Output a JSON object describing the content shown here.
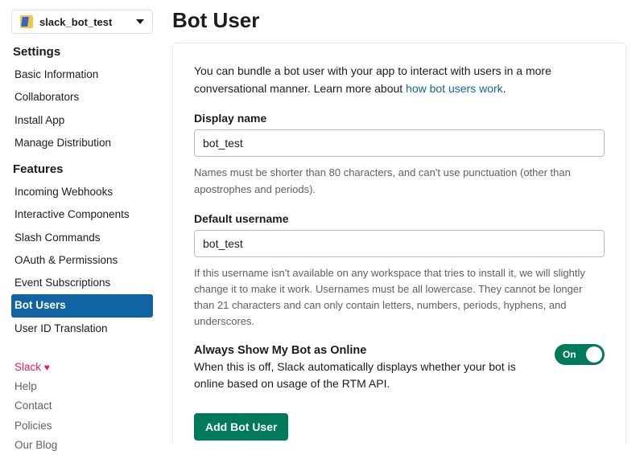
{
  "app_selector": {
    "name": "slack_bot_test"
  },
  "sidebar": {
    "settings_heading": "Settings",
    "settings_items": [
      "Basic Information",
      "Collaborators",
      "Install App",
      "Manage Distribution"
    ],
    "features_heading": "Features",
    "features_items": [
      "Incoming Webhooks",
      "Interactive Components",
      "Slash Commands",
      "OAuth & Permissions",
      "Event Subscriptions",
      "Bot Users",
      "User ID Translation"
    ],
    "active_feature_index": 5,
    "footer_items": [
      "Slack",
      "Help",
      "Contact",
      "Policies",
      "Our Blog"
    ]
  },
  "page": {
    "title": "Bot User",
    "intro_text": "You can bundle a bot user with your app to interact with users in a more conversational manner. Learn more about ",
    "intro_link": "how bot users work",
    "intro_after": ".",
    "display_name": {
      "label": "Display name",
      "value": "bot_test",
      "help": "Names must be shorter than 80 characters, and can't use punctuation (other than apostrophes and periods)."
    },
    "default_username": {
      "label": "Default username",
      "value": "bot_test",
      "help": "If this username isn't available on any workspace that tries to install it, we will slightly change it to make it work. Usernames must be all lowercase. They cannot be longer than 21 characters and can only contain letters, numbers, periods, hyphens, and underscores."
    },
    "online_toggle": {
      "label": "Always Show My Bot as Online",
      "desc": "When this is off, Slack automatically displays whether your bot is online based on usage of the RTM API.",
      "state_text": "On",
      "on": true
    },
    "submit_label": "Add Bot User"
  }
}
